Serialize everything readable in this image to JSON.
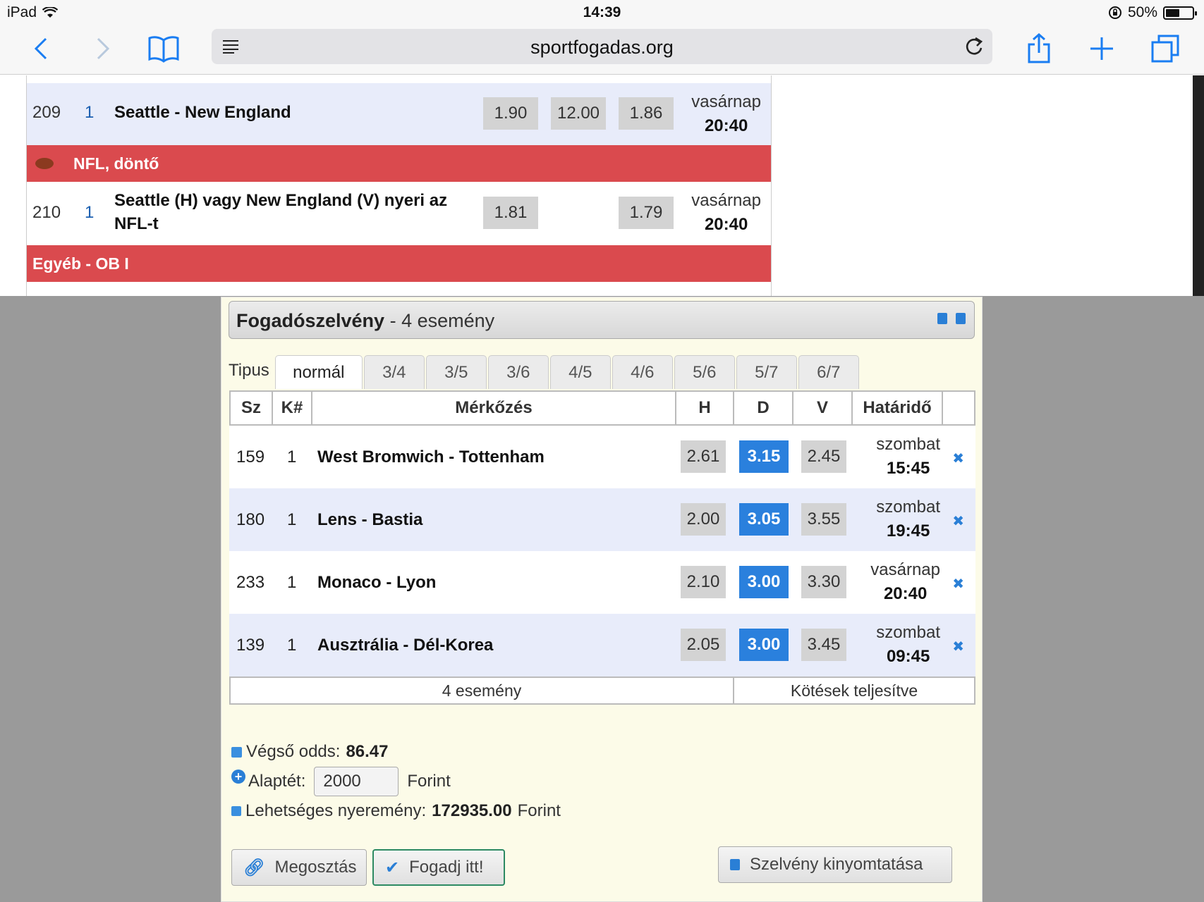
{
  "status": {
    "device": "iPad",
    "time": "14:39",
    "battery": "50%"
  },
  "browser": {
    "url": "sportfogadas.org"
  },
  "events": [
    {
      "num": "209",
      "k": "1",
      "match": "Seattle - New England",
      "odds": [
        "1.90",
        "12.00",
        "1.86"
      ],
      "day": "vasárnap",
      "time": "20:40"
    },
    {
      "num": "210",
      "k": "1",
      "match": "Seattle (H) vagy New England (V) nyeri az NFL-t",
      "odds": [
        "1.81",
        "",
        "1.79"
      ],
      "day": "vasárnap",
      "time": "20:40"
    }
  ],
  "categories": {
    "nfl": "NFL, döntő",
    "other": "Egyéb - OB I"
  },
  "slip": {
    "title": "Fogadószelvény",
    "subtitle": "- 4 esemény",
    "type_label": "Tipus",
    "tabs": [
      "normál",
      "3/4",
      "3/5",
      "3/6",
      "4/5",
      "4/6",
      "5/6",
      "5/7",
      "6/7"
    ],
    "headers": {
      "sz": "Sz",
      "k": "K#",
      "match": "Mérkőzés",
      "h": "H",
      "d": "D",
      "v": "V",
      "deadline": "Határidő"
    },
    "rows": [
      {
        "num": "159",
        "k": "1",
        "match": "West Bromwich - Tottenham",
        "h": "2.61",
        "d": "3.15",
        "v": "2.45",
        "day": "szombat",
        "time": "15:45"
      },
      {
        "num": "180",
        "k": "1",
        "match": "Lens - Bastia",
        "h": "2.00",
        "d": "3.05",
        "v": "3.55",
        "day": "szombat",
        "time": "19:45"
      },
      {
        "num": "233",
        "k": "1",
        "match": "Monaco - Lyon",
        "h": "2.10",
        "d": "3.00",
        "v": "3.30",
        "day": "vasárnap",
        "time": "20:40"
      },
      {
        "num": "139",
        "k": "1",
        "match": "Ausztrália - Dél-Korea",
        "h": "2.05",
        "d": "3.00",
        "v": "3.45",
        "day": "szombat",
        "time": "09:45"
      }
    ],
    "footer": {
      "count": "4 esemény",
      "status": "Kötések teljesítve"
    },
    "final_odds_label": "Végső odds:",
    "final_odds": "86.47",
    "stake_label": "Alaptét:",
    "stake_value": "2000",
    "currency": "Forint",
    "win_label": "Lehetséges nyeremény:",
    "win_value": "172935.00",
    "buttons": {
      "share": "Megosztás",
      "bet": "Fogadj itt!",
      "print": "Szelvény kinyomtatása"
    }
  }
}
